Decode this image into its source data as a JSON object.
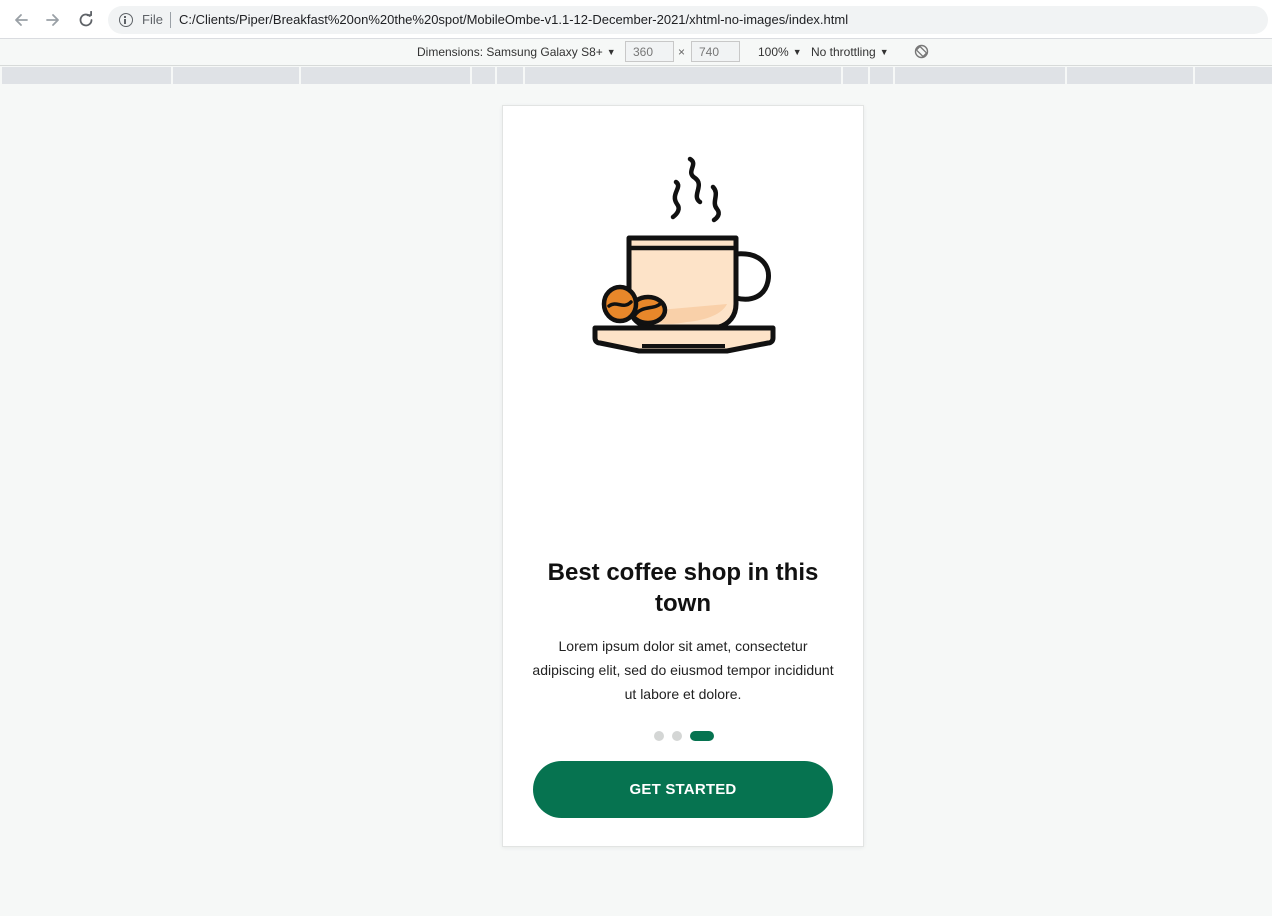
{
  "browser": {
    "file_label": "File",
    "url": "C:/Clients/Piper/Breakfast%20on%20the%20spot/MobileOmbe-v1.1-12-December-2021/xhtml-no-images/index.html"
  },
  "device_toolbar": {
    "dimensions_label": "Dimensions: Samsung Galaxy S8+",
    "width": "360",
    "times": "×",
    "height": "740",
    "zoom": "100%",
    "throttling": "No throttling",
    "caret": "▼"
  },
  "onboarding": {
    "illustration": "coffee-cup-icon",
    "title": "Best coffee shop in this town",
    "description": "Lorem ipsum dolor sit amet, consectetur adipiscing elit, sed do eiusmod tempor incididunt ut labore et dolore.",
    "pagination": {
      "total": 3,
      "active": 3
    },
    "cta_label": "GET STARTED"
  },
  "colors": {
    "primary": "#067350",
    "cup_fill": "#fde3c8",
    "bean": "#e8872a"
  }
}
